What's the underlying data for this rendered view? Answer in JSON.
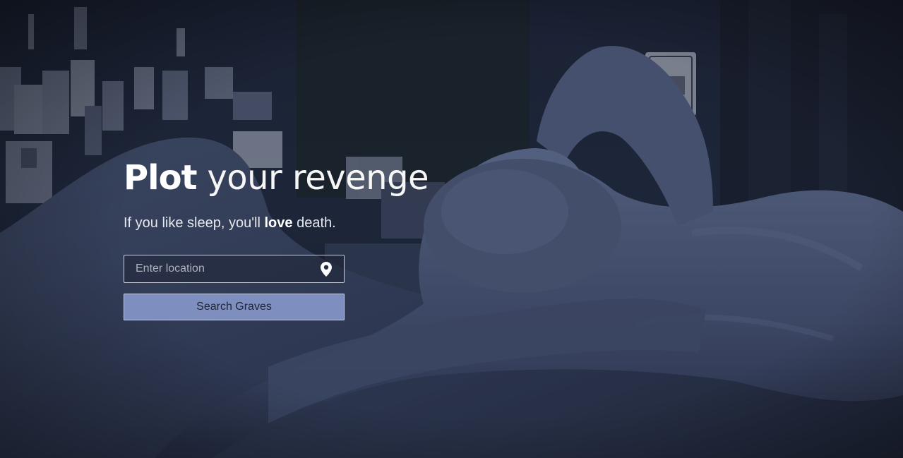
{
  "hero": {
    "headline_strong": "Plot",
    "headline_light": "your revenge",
    "tagline_before": "If you like sleep, you'll ",
    "tagline_emphasis": "love",
    "tagline_after": " death."
  },
  "search": {
    "location_placeholder": "Enter location",
    "location_value": "",
    "button_label": "Search Graves"
  },
  "icons": {
    "location": "map-pin-icon"
  },
  "colors": {
    "overlay": "#1a2033",
    "button_background": "#7e8fbf",
    "button_text": "#1e2536",
    "headline": "#ffffff"
  }
}
